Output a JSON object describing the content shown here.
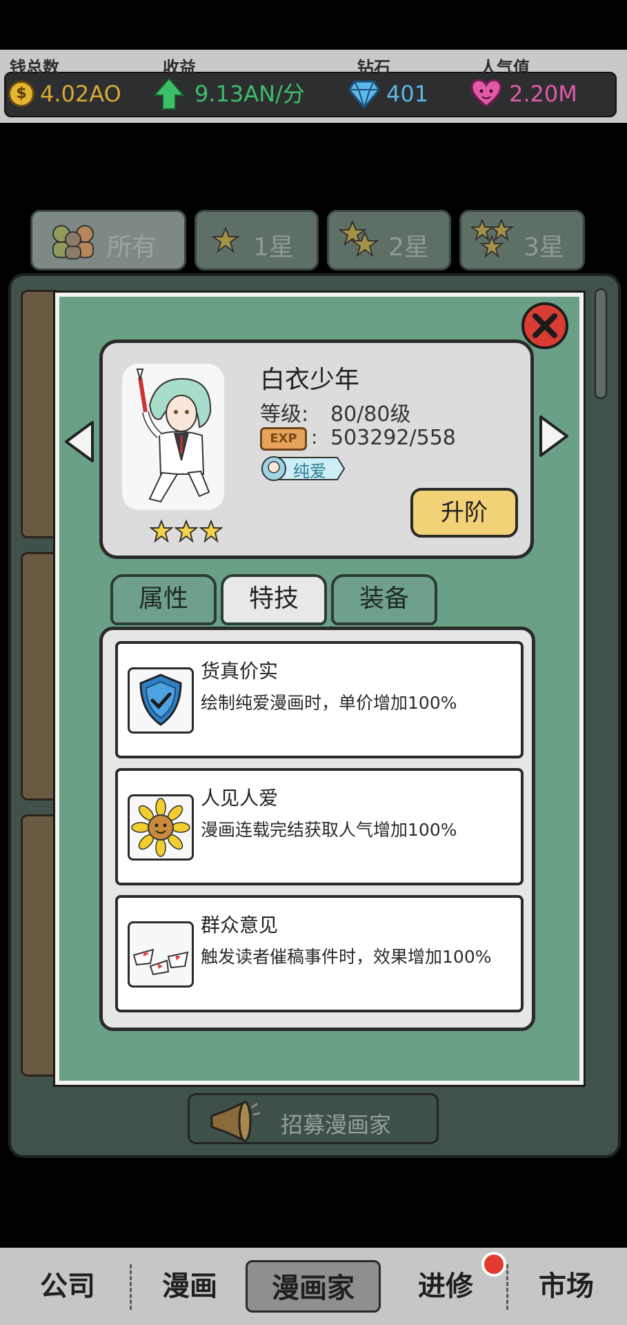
{
  "top_bar": {
    "money_label": "钱总数",
    "money_value": "4.02AO",
    "income_label": "收益",
    "income_value": "9.13AN/分",
    "diamond_label": "钻石",
    "diamond_value": "401",
    "popularity_label": "人气值",
    "popularity_value": "2.20M",
    "coin_symbol": "$",
    "colors": {
      "money": "#d8a933",
      "income": "#3dbf67",
      "diamond": "#5cb7e8",
      "popularity": "#e05aa8"
    }
  },
  "filter_tabs": [
    {
      "label": "所有",
      "active": true
    },
    {
      "label": "1星",
      "active": false
    },
    {
      "label": "2星",
      "active": false
    },
    {
      "label": "3星",
      "active": false
    }
  ],
  "artist": {
    "name": "白衣少年",
    "level_label": "等级:",
    "level_value": "80/80级",
    "exp_badge": "EXP",
    "exp_colon": ":",
    "exp_value": "503292/558",
    "genre": "纯爱",
    "stars": 3,
    "upgrade_label": "升阶"
  },
  "detail_tabs": [
    {
      "label": "属性",
      "active": false
    },
    {
      "label": "特技",
      "active": true
    },
    {
      "label": "装备",
      "active": false
    }
  ],
  "skills": [
    {
      "title": "货真价实",
      "desc": "绘制纯爱漫画时，单价增加100%",
      "icon": "shield-check-icon"
    },
    {
      "title": "人见人爱",
      "desc": "漫画连载完结获取人气增加100%",
      "icon": "sunflower-icon"
    },
    {
      "title": "群众意见",
      "desc": "触发读者催稿事件时，效果增加100%",
      "icon": "letters-icon"
    }
  ],
  "recruit_label": "招募漫画家",
  "bottom_nav": [
    {
      "label": "公司",
      "active": false
    },
    {
      "label": "漫画",
      "active": false
    },
    {
      "label": "漫画家",
      "active": true
    },
    {
      "label": "进修",
      "active": false,
      "badge": true
    },
    {
      "label": "市场",
      "active": false
    }
  ]
}
